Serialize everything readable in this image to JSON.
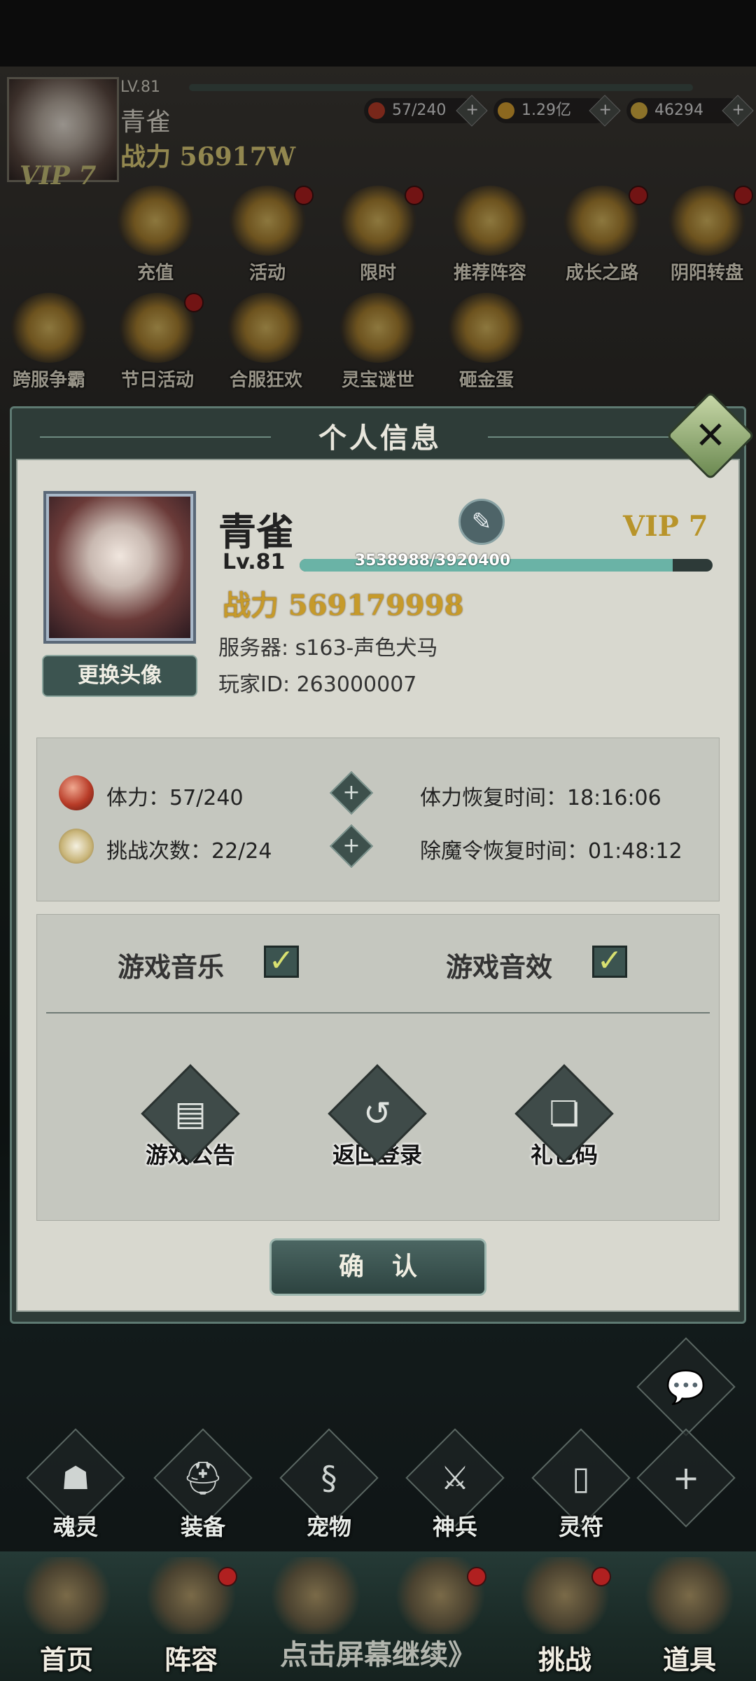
{
  "top_hud": {
    "level": "LV.81",
    "name": "青雀",
    "power": "战力 56917W",
    "vip": "VIP 7",
    "resources": [
      {
        "icon": "stamina-orb-icon",
        "value": "57/240",
        "color": "#b83c28"
      },
      {
        "icon": "coin-icon",
        "value": "1.29亿",
        "color": "#d8a030"
      },
      {
        "icon": "ingot-icon",
        "value": "46294",
        "color": "#d8b040"
      }
    ]
  },
  "activities_row1": [
    {
      "label": "充值",
      "badge": false
    },
    {
      "label": "活动",
      "badge": true
    },
    {
      "label": "限时",
      "badge": true
    },
    {
      "label": "推荐阵容",
      "badge": false
    },
    {
      "label": "成长之路",
      "badge": true
    },
    {
      "label": "阴阳转盘",
      "badge": true
    }
  ],
  "activities_row2": [
    {
      "label": "跨服争霸",
      "badge": false
    },
    {
      "label": "节日活动",
      "badge": true
    },
    {
      "label": "合服狂欢",
      "badge": false
    },
    {
      "label": "灵宝谜世",
      "badge": false
    },
    {
      "label": "砸金蛋",
      "badge": false
    }
  ],
  "modal": {
    "title": "个人信息",
    "close_icon": "close-icon",
    "player": {
      "name": "青雀",
      "vip": "VIP 7",
      "level": "Lv.81",
      "exp": "3538988/3920400",
      "exp_fraction": 0.903,
      "power": "战力 569179998",
      "server": "服务器: s163-声色犬马",
      "player_id": "玩家ID: 263000007",
      "change_avatar": "更换头像"
    },
    "stats": {
      "stamina": "体力：57/240",
      "stamina_recover": "体力恢复时间：18:16:06",
      "challenges": "挑战次数：22/24",
      "token_recover": "除魔令恢复时间：01:48:12"
    },
    "settings": {
      "music": "游戏音乐",
      "music_on": true,
      "sfx": "游戏音效",
      "sfx_on": true
    },
    "system_buttons": [
      {
        "label": "游戏公告",
        "icon": "notice-icon"
      },
      {
        "label": "返回登录",
        "icon": "return-icon"
      },
      {
        "label": "礼包码",
        "icon": "gift-code-icon"
      }
    ],
    "confirm": "确认"
  },
  "quick_buttons": [
    "魂灵",
    "装备",
    "宠物",
    "神兵",
    "灵符"
  ],
  "nav": [
    {
      "label": "首页",
      "badge": false
    },
    {
      "label": "阵容",
      "badge": true
    },
    {
      "label": "",
      "badge": false
    },
    {
      "label": "",
      "badge": true
    },
    {
      "label": "挑战",
      "badge": true
    },
    {
      "label": "道具",
      "badge": false
    }
  ],
  "hint": "点击屏幕继续》"
}
